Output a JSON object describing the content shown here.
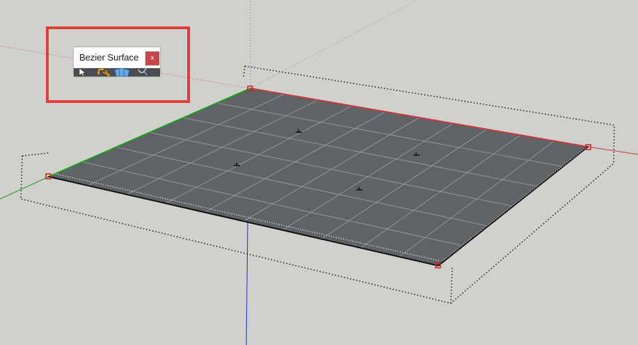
{
  "toolbar": {
    "title": "Bezier Surface",
    "close_label": "x",
    "tools": [
      {
        "name": "select-arrow-icon"
      },
      {
        "name": "move-arrows-icon"
      },
      {
        "name": "surface-icon"
      },
      {
        "name": "curve-icon"
      }
    ]
  },
  "colors": {
    "background": "#d0d0cc",
    "surface_fill": "#5f6368",
    "grid_line": "#9aa0a6",
    "control_point": "#d22020",
    "axis_red": "#c83c3c",
    "axis_green": "#1e9e1e",
    "axis_blue": "#2828c8",
    "highlight": "#e53b3b",
    "close_button": "#c8454a"
  }
}
